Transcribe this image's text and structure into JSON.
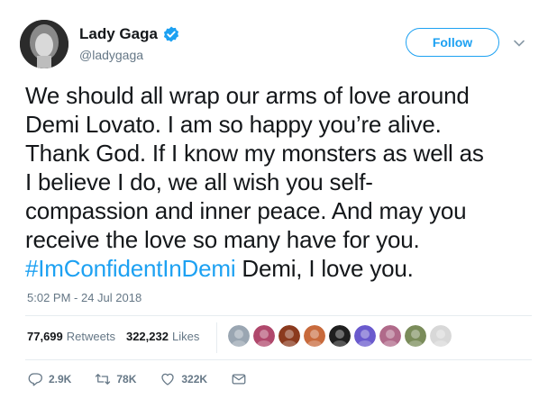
{
  "author": {
    "display_name": "Lady Gaga",
    "handle": "@ladygaga",
    "verified": true
  },
  "follow_button": {
    "label": "Follow"
  },
  "tweet": {
    "lines": [
      "We should all wrap our arms of love around",
      "Demi Lovato. I am so happy you’re alive.",
      "Thank God. If I know my monsters as well as",
      "I believe I do, we all wish you self-",
      "compassion and inner peace. And may you",
      "receive the love so many have for you."
    ],
    "hashtag": "#ImConfidentInDemi",
    "after_hashtag": " Demi, I love you.",
    "timestamp": "5:02 PM - 24 Jul 2018"
  },
  "stats": {
    "retweets_count": "77,699",
    "retweets_label": "Retweets",
    "likes_count": "322,232",
    "likes_label": "Likes"
  },
  "likers": [
    {
      "icon": "avatar-1",
      "color": "#9aa6b2"
    },
    {
      "icon": "avatar-2",
      "color": "#b0486c"
    },
    {
      "icon": "avatar-3",
      "color": "#8b3a1e"
    },
    {
      "icon": "avatar-4",
      "color": "#c86a3c"
    },
    {
      "icon": "avatar-5",
      "color": "#1f1f1f"
    },
    {
      "icon": "avatar-6",
      "color": "#6a5acd"
    },
    {
      "icon": "avatar-7",
      "color": "#b06a8a"
    },
    {
      "icon": "avatar-8",
      "color": "#7a8c5a"
    },
    {
      "icon": "avatar-9",
      "color": "#d8d8d8"
    }
  ],
  "actions": {
    "replies": "2.9K",
    "retweets": "78K",
    "likes": "322K"
  },
  "colors": {
    "accent": "#1da1f2",
    "text": "#14171a",
    "secondary": "#657786",
    "divider": "#e6ecf0"
  }
}
